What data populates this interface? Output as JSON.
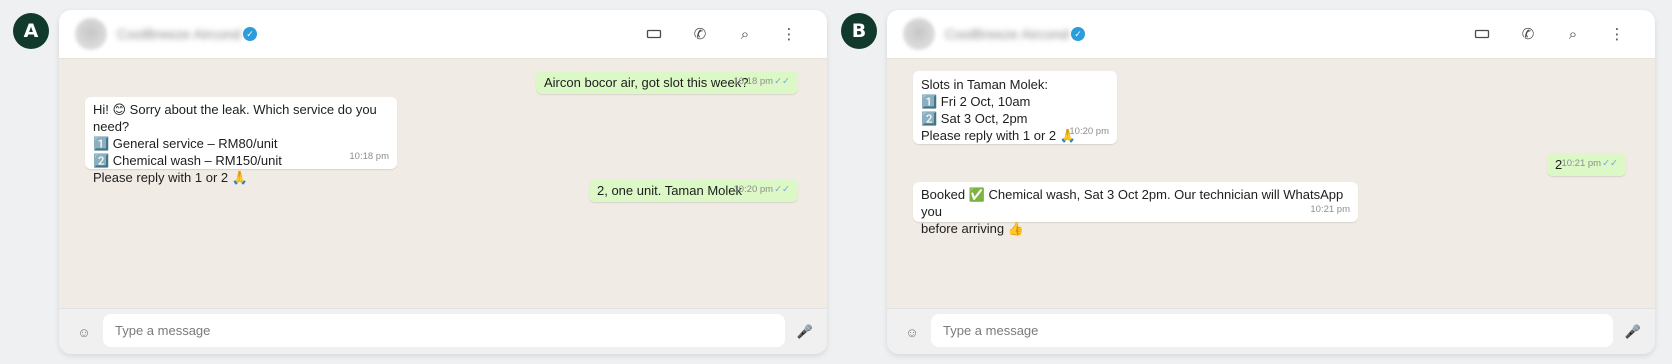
{
  "panels": [
    {
      "label": "A",
      "contact_name": "CoolBreeze Aircond",
      "composer_placeholder": "Type a message",
      "messages": [
        {
          "dir": "out",
          "text": "Aircon bocor air, got slot this week?",
          "time": "10:18 pm",
          "ticks": "✓✓"
        },
        {
          "dir": "in",
          "text": "Hi! 😊 Sorry about the leak. Which service do you need?\n1️⃣ General service – RM80/unit\n2️⃣ Chemical wash – RM150/unit\nPlease reply with 1 or 2 🙏",
          "time": "10:18 pm"
        },
        {
          "dir": "out",
          "text": "2, one unit. Taman Molek",
          "time": "10:20 pm",
          "ticks": "✓✓"
        }
      ]
    },
    {
      "label": "B",
      "contact_name": "CoolBreeze Aircond",
      "composer_placeholder": "Type a message",
      "messages": [
        {
          "dir": "in",
          "text": "Slots in Taman Molek:\n1️⃣ Fri 2 Oct, 10am\n2️⃣ Sat 3 Oct, 2pm\nPlease reply with 1 or 2 🙏",
          "time": "10:20 pm"
        },
        {
          "dir": "out",
          "text": "2",
          "time": "10:21 pm",
          "ticks": "✓✓"
        },
        {
          "dir": "in",
          "text": "Booked ✅ Chemical wash, Sat 3 Oct 2pm. Our technician will WhatsApp you\nbefore arriving 👍",
          "time": "10:21 pm"
        }
      ]
    }
  ],
  "icons": {
    "verified": "verified-check-icon",
    "video": "video-icon",
    "phone": "phone-icon",
    "search": "search-icon",
    "menu": "more-vertical-icon",
    "emoji": "emoji-icon",
    "mic": "microphone-icon"
  },
  "colors": {
    "badge": "#113a2d",
    "header": "#ffffff",
    "chat_bg": "#f0ebe4",
    "incoming": "#ffffff",
    "outgoing": "#dcf8c6",
    "tick": "#7aa6d0",
    "verified": "#2d9cdb"
  }
}
